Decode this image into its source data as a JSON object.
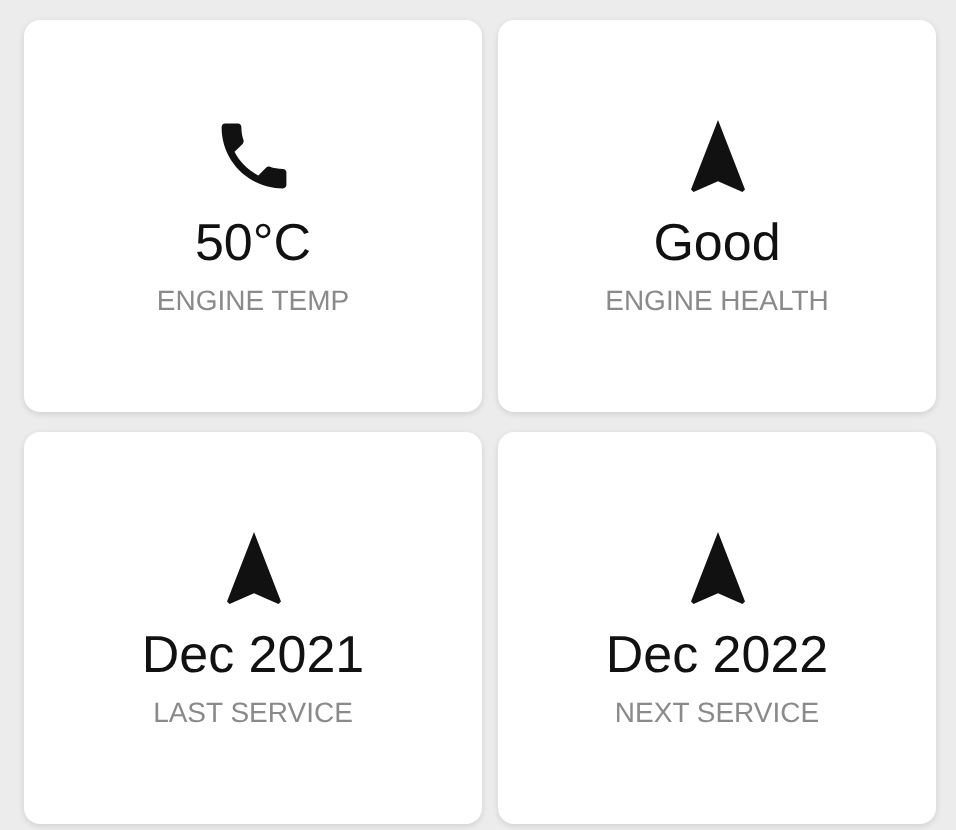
{
  "cards": [
    {
      "kind": "phone",
      "value": "50°C",
      "label": "ENGINE TEMP"
    },
    {
      "kind": "navigation",
      "value": "Good",
      "label": "ENGINE HEALTH"
    },
    {
      "kind": "navigation",
      "value": "Dec 2021",
      "label": "LAST SERVICE"
    },
    {
      "kind": "navigation",
      "value": "Dec 2022",
      "label": "NEXT SERVICE"
    }
  ]
}
